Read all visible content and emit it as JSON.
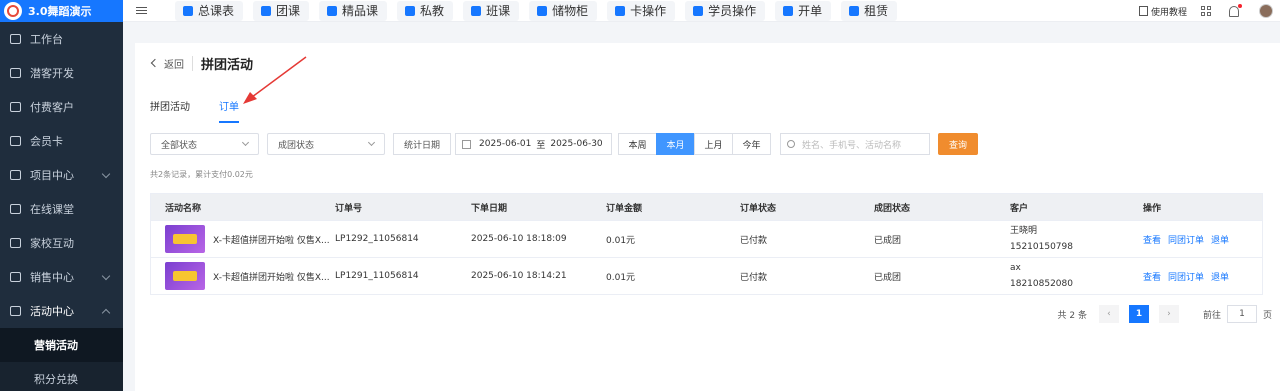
{
  "app": {
    "title": "3.0舞蹈演示"
  },
  "sidebar": {
    "items": [
      {
        "label": "工作台"
      },
      {
        "label": "潜客开发"
      },
      {
        "label": "付费客户"
      },
      {
        "label": "会员卡"
      },
      {
        "label": "项目中心"
      },
      {
        "label": "在线课堂"
      },
      {
        "label": "家校互动"
      },
      {
        "label": "销售中心"
      },
      {
        "label": "活动中心"
      }
    ],
    "sub_items": [
      {
        "label": "营销活动"
      },
      {
        "label": "积分兑换"
      }
    ]
  },
  "topbar": {
    "quick_buttons": [
      "总课表",
      "团课",
      "精品课",
      "私教",
      "班课",
      "储物柜",
      "卡操作",
      "学员操作",
      "开单",
      "租赁"
    ],
    "help_label": "使用教程"
  },
  "page": {
    "back_label": "返回",
    "title": "拼团活动",
    "tabs": [
      "拼团活动",
      "订单"
    ]
  },
  "filters": {
    "status_select": "全部状态",
    "group_status_select": "成团状态",
    "date_label": "统计日期",
    "date_start": "2025-06-01",
    "date_sep": "至",
    "date_end": "2025-06-30",
    "ranges": [
      "本周",
      "本月",
      "上月",
      "今年"
    ],
    "search_placeholder": "姓名、手机号、活动名称",
    "query_label": "查询"
  },
  "summary": "共2条记录，累计支付0.02元",
  "table": {
    "headers": [
      "活动名称",
      "订单号",
      "下单日期",
      "订单金额",
      "订单状态",
      "成团状态",
      "客户",
      "操作"
    ],
    "rows": [
      {
        "name": "X-卡超值拼团开始啦 仅售X...",
        "order_no": "LP1292_11056814",
        "date": "2025-06-10 18:18:09",
        "amount": "0.01元",
        "order_status": "已付款",
        "group_status": "已成团",
        "customer_name": "王晓明",
        "customer_phone": "15210150798",
        "actions": [
          "查看",
          "同团订单",
          "退单"
        ]
      },
      {
        "name": "X-卡超值拼团开始啦 仅售X...",
        "order_no": "LP1291_11056814",
        "date": "2025-06-10 18:14:21",
        "amount": "0.01元",
        "order_status": "已付款",
        "group_status": "已成团",
        "customer_name": "ax",
        "customer_phone": "18210852080",
        "actions": [
          "查看",
          "同团订单",
          "退单"
        ]
      }
    ]
  },
  "pagination": {
    "total": "共 2 条",
    "current": "1",
    "goto_label": "前往",
    "goto_value": "1",
    "page_suffix": "页"
  },
  "colors": {
    "accent": "#1677ff",
    "sidebar": "#1f2d3d",
    "query": "#f08c2e",
    "annotation": "#e53935"
  }
}
